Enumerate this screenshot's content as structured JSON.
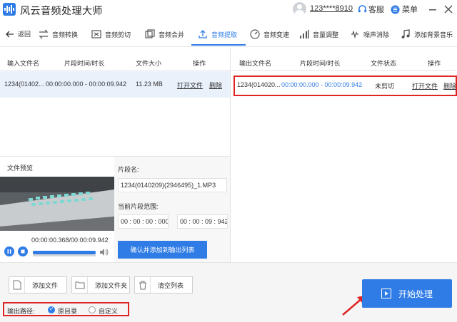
{
  "app": {
    "title": "风云音频处理大师",
    "user_id": "123****8910",
    "service_label": "客服",
    "menu_label": "菜单"
  },
  "toolbar": {
    "back": "返回",
    "items": [
      "音频转换",
      "音频剪切",
      "音频合并",
      "音频提取",
      "音频变速",
      "音量调整",
      "噪声消除",
      "添加背景音乐"
    ],
    "active_index": 3
  },
  "input_table": {
    "headers": [
      "输入文件名",
      "片段时间/时长",
      "文件大小",
      "操作"
    ],
    "rows": [
      {
        "name": "1234(01402...",
        "time": "00:00:00.000 - 00:00:09.942",
        "size": "11.23 MB",
        "open": "打开文件",
        "delete": "删除"
      }
    ]
  },
  "output_table": {
    "headers": [
      "输出文件名",
      "片段时间/时长",
      "文件状态",
      "操作"
    ],
    "rows": [
      {
        "name": "1234(014020...",
        "time": "00:00:00.000 - 00:00:09.942",
        "status": "未剪切",
        "open": "打开文件",
        "delete": "删除"
      }
    ]
  },
  "preview": {
    "label": "文件预览",
    "time_readout": "00:00:00.368/00:00:09.942",
    "progress": 0.04
  },
  "segment": {
    "name_label": "片段名:",
    "name_value": "1234(0140209)(2946495)_1.MP3",
    "range_label": "当前片段范围:",
    "start": "00 : 00 : 00 : 000",
    "end": "00 : 00 : 09 : 942",
    "confirm": "确认并添加到输出列表"
  },
  "bottom": {
    "add_file": "添加文件",
    "add_folder": "添加文件夹",
    "clear_list": "清空列表",
    "output_path_label": "输出路径:",
    "option_original": "原目录",
    "option_custom": "自定义",
    "start": "开始处理"
  },
  "colors": {
    "accent": "#2f7ce6",
    "highlight": "#e02424"
  }
}
